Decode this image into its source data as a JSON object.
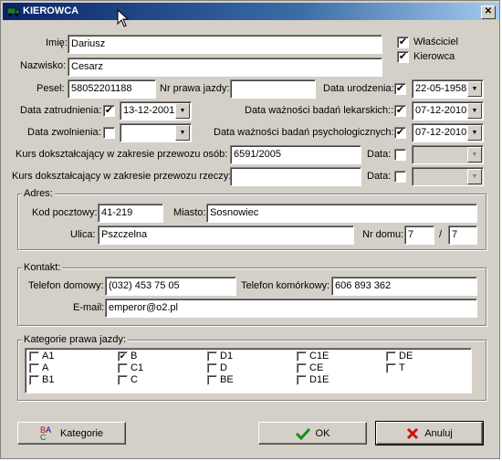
{
  "window": {
    "title": "KIEROWCA",
    "close_glyph": "✕"
  },
  "form": {
    "imie": {
      "label": "Imię:",
      "value": "Dariusz"
    },
    "nazwisko": {
      "label": "Nazwisko:",
      "value": "Cesarz"
    },
    "wlasciciel": {
      "label": "Właściciel",
      "checked": true
    },
    "kierowca": {
      "label": "Kierowca",
      "checked": true
    },
    "pesel": {
      "label": "Pesel:",
      "value": "58052201188"
    },
    "nr_prawa": {
      "label": "Nr prawa jazdy:",
      "value": ""
    },
    "data_urodzenia": {
      "label": "Data urodzenia:",
      "checked": true,
      "value": "22-05-1958"
    },
    "data_zatrudnienia": {
      "label": "Data zatrudnienia:",
      "checked": true,
      "value": "13-12-2001"
    },
    "badania_lek": {
      "label": "Data ważności badań lekarskich::",
      "checked": true,
      "value": "07-12-2010"
    },
    "data_zwolnienia": {
      "label": "Data zwolnienia:",
      "checked": false,
      "value": ""
    },
    "badania_psych": {
      "label": "Data ważności badań psychologicznych:",
      "checked": true,
      "value": "07-12-2010"
    },
    "kurs_osob": {
      "label": "Kurs dokształcający w zakresie przewozu osób:",
      "value": "6591/2005",
      "data_label": "Data:",
      "checked": false,
      "date": ""
    },
    "kurs_rzeczy": {
      "label": "Kurs dokształcający w zakresie przewozu rzeczy:",
      "value": "",
      "data_label": "Data:",
      "checked": false,
      "date": ""
    }
  },
  "adres": {
    "group_label": "Adres:",
    "kod": {
      "label": "Kod pocztowy:",
      "value": "41-219"
    },
    "miasto": {
      "label": "Miasto:",
      "value": "Sosnowiec"
    },
    "ulica": {
      "label": "Ulica:",
      "value": "Pszczelna"
    },
    "nr_domu": {
      "label": "Nr domu:",
      "value": "7",
      "sep": "/",
      "value2": "7"
    }
  },
  "kontakt": {
    "group_label": "Kontakt:",
    "tel_dom": {
      "label": "Telefon domowy:",
      "value": "(032) 453 75 05"
    },
    "tel_kom": {
      "label": "Telefon komórkowy:",
      "value": "606 893 362"
    },
    "email": {
      "label": "E-mail:",
      "value": "emperor@o2.pl"
    }
  },
  "kategorie": {
    "group_label": "Kategorie prawa jazdy:",
    "items": [
      {
        "label": "A1",
        "checked": false
      },
      {
        "label": "A",
        "checked": false
      },
      {
        "label": "B1",
        "checked": false
      },
      {
        "label": "B",
        "checked": true
      },
      {
        "label": "C1",
        "checked": false
      },
      {
        "label": "C",
        "checked": false
      },
      {
        "label": "D1",
        "checked": false
      },
      {
        "label": "D",
        "checked": false
      },
      {
        "label": "BE",
        "checked": false
      },
      {
        "label": "C1E",
        "checked": false
      },
      {
        "label": "CE",
        "checked": false
      },
      {
        "label": "D1E",
        "checked": false
      },
      {
        "label": "DE",
        "checked": false
      },
      {
        "label": "T",
        "checked": false
      }
    ]
  },
  "buttons": {
    "kategorie": "Kategorie",
    "ok": "OK",
    "anuluj": "Anuluj"
  },
  "glyphs": {
    "check": "✔",
    "dropdown": "▼"
  },
  "icons": {
    "app": "truck-icon",
    "kategorie": "abc-icon",
    "ok": "green-check-icon",
    "anuluj": "red-x-icon"
  }
}
